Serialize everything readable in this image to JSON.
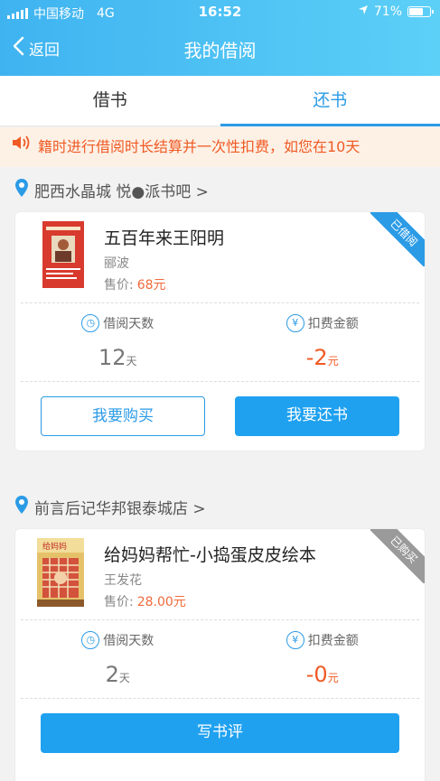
{
  "status": {
    "carrier": "中国移动",
    "network": "4G",
    "time": "16:52",
    "battery": "71%",
    "battery_level": 0.71
  },
  "nav": {
    "back_label": "返回",
    "title": "我的借阅"
  },
  "tabs": [
    {
      "label": "借书"
    },
    {
      "label": "还书"
    }
  ],
  "active_tab": 1,
  "notice": {
    "text": "籍时进行借阅时长结算并一次性扣费，如您在10天"
  },
  "stores": [
    {
      "name": "肥西水晶城 悦●派书吧 >",
      "book": {
        "title": "五百年来王阳明",
        "author": "郦波",
        "price_label": "售价:",
        "price": "68元",
        "tag": "已借阅",
        "tag_color": "#2b9be6"
      },
      "stats": {
        "days_label": "借阅天数",
        "days_value": "12",
        "days_unit": "天",
        "fee_label": "扣费金额",
        "fee_value": "-2",
        "fee_unit": "元"
      },
      "buttons": {
        "buy": "我要购买",
        "return": "我要还书"
      }
    },
    {
      "name": "前言后记华邦银泰城店 >",
      "book": {
        "title": "给妈妈帮忙-小捣蛋皮皮绘本",
        "author": "王发花",
        "price_label": "售价:",
        "price": "28.00元",
        "tag": "已购买",
        "tag_color": "#9a9a9a"
      },
      "stats": {
        "days_label": "借阅天数",
        "days_value": "2",
        "days_unit": "天",
        "fee_label": "扣费金额",
        "fee_value": "-0",
        "fee_unit": "元"
      },
      "buttons": {
        "review": "写书评"
      }
    }
  ]
}
